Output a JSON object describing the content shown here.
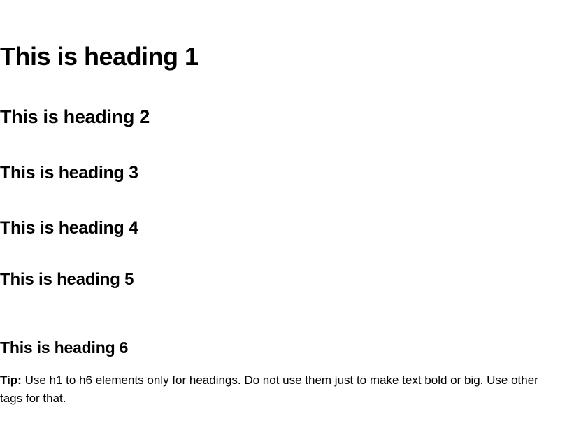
{
  "headings": {
    "h1": "This is heading 1",
    "h2": "This is heading 2",
    "h3": "This is heading 3",
    "h4": "This is heading 4",
    "h5": "This is heading 5",
    "h6": "This is heading 6"
  },
  "tip": {
    "label": "Tip:",
    "text": " Use h1 to h6 elements only for headings. Do not use them just to make text bold or big. Use other tags for that."
  }
}
